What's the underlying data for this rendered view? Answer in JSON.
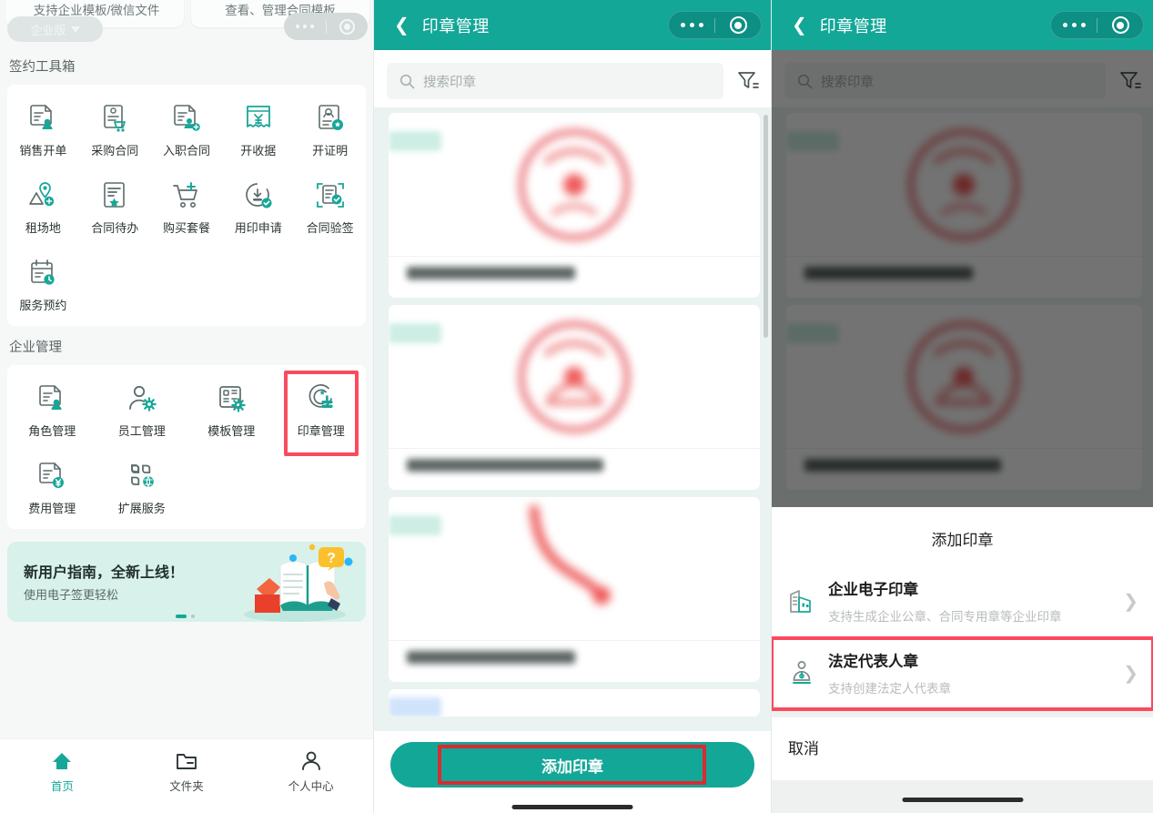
{
  "home": {
    "top_cards": [
      {
        "sub": "支持企业模板/微信文件"
      },
      {
        "sub": "查看、管理合同模板"
      }
    ],
    "biz_pill": "企业版",
    "sections": [
      {
        "title": "签约工具箱",
        "items": [
          {
            "label": "销售开单",
            "icon": "sales-invoice-icon"
          },
          {
            "label": "采购合同",
            "icon": "purchase-contract-icon"
          },
          {
            "label": "入职合同",
            "icon": "onboarding-contract-icon"
          },
          {
            "label": "开收据",
            "icon": "receipt-icon"
          },
          {
            "label": "开证明",
            "icon": "certificate-icon"
          },
          {
            "label": "租场地",
            "icon": "venue-rental-icon"
          },
          {
            "label": "合同待办",
            "icon": "contract-todo-icon"
          },
          {
            "label": "购买套餐",
            "icon": "buy-package-icon"
          },
          {
            "label": "用印申请",
            "icon": "seal-apply-icon"
          },
          {
            "label": "合同验签",
            "icon": "contract-verify-icon"
          },
          {
            "label": "服务预约",
            "icon": "service-booking-icon"
          }
        ]
      },
      {
        "title": "企业管理",
        "items": [
          {
            "label": "角色管理",
            "icon": "role-manage-icon",
            "marked": false
          },
          {
            "label": "员工管理",
            "icon": "staff-manage-icon",
            "marked": false
          },
          {
            "label": "模板管理",
            "icon": "template-manage-icon",
            "marked": false
          },
          {
            "label": "印章管理",
            "icon": "seal-manage-icon",
            "marked": true
          },
          {
            "label": "费用管理",
            "icon": "fee-manage-icon",
            "marked": false
          },
          {
            "label": "扩展服务",
            "icon": "extension-service-icon",
            "marked": false
          }
        ]
      }
    ],
    "promo": {
      "title": "新用户指南，全新上线！",
      "subtitle": "使用电子签更轻松"
    },
    "tabs": [
      {
        "label": "首页",
        "icon": "home-icon",
        "active": true
      },
      {
        "label": "文件夹",
        "icon": "folder-icon",
        "active": false
      },
      {
        "label": "个人中心",
        "icon": "person-icon",
        "active": false
      }
    ]
  },
  "seal_list": {
    "nav_title": "印章管理",
    "back_icon": "back-chevron-icon",
    "search_placeholder": "搜索印章",
    "search_value": "",
    "search_icon": "search-icon",
    "filter_icon": "filter-icon",
    "cards": [
      {
        "stamp": "round-company-seal",
        "blurred": true
      },
      {
        "stamp": "round-company-seal",
        "blurred": true
      },
      {
        "stamp": "handwritten-signature",
        "blurred": true
      },
      {
        "stamp": "partial-card",
        "blurred": true
      }
    ],
    "primary_button": "添加印章"
  },
  "sheet_screen": {
    "nav_title": "印章管理",
    "search_placeholder": "搜索印章",
    "sheet_title": "添加印章",
    "options": [
      {
        "icon": "company-building-icon",
        "title": "企业电子印章",
        "subtitle": "支持生成企业公章、合同专用章等企业印章",
        "chevron": "chevron-right-icon",
        "marked": false
      },
      {
        "icon": "legal-person-icon",
        "title": "法定代表人章",
        "subtitle": "支持创建法定人代表章",
        "chevron": "chevron-right-icon",
        "marked": true
      }
    ],
    "cancel_label": "取消"
  },
  "colors": {
    "brand_teal": "#13a798",
    "highlight_red": "#fa4a5e",
    "button_mark_red": "#d92b30",
    "page_bg": "#eaf3f1"
  }
}
